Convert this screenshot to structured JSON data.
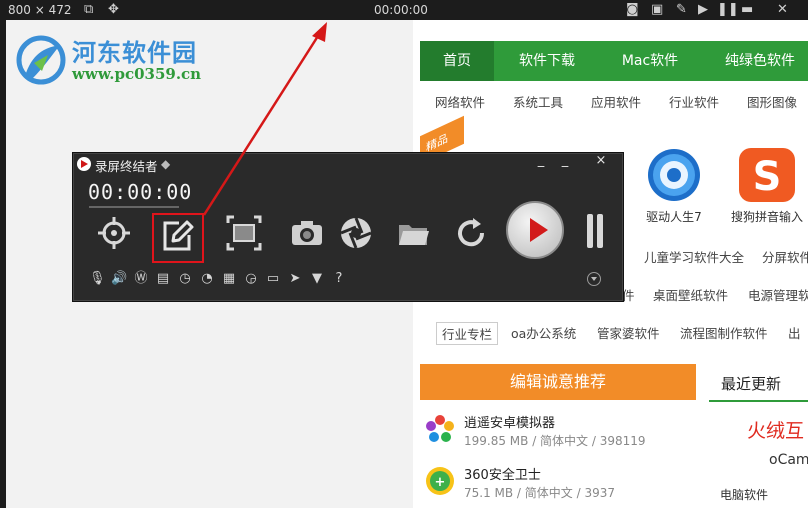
{
  "topbar": {
    "dimensions": "800 × 472",
    "time": "00:00:00"
  },
  "watermark": {
    "title": "河东软件园",
    "url": "www.pc0359.cn"
  },
  "site": {
    "nav": [
      "首页",
      "软件下载",
      "Mac软件",
      "纯绿色软件"
    ],
    "subnav": [
      "网络软件",
      "系统工具",
      "应用软件",
      "行业软件",
      "图形图像"
    ],
    "badge": "精品",
    "apps": [
      "驱动人生7",
      "搜狗拼音输入"
    ],
    "cat_row1": [
      "儿童学习软件大全",
      "分屏软件"
    ],
    "cat_row2": [
      "件",
      "桌面壁纸软件",
      "电源管理软"
    ],
    "cat_row3": [
      "行业专栏",
      "oa办公系统",
      "管家婆软件",
      "流程图制作软件",
      "出"
    ],
    "hot_title": "编辑诚意推荐",
    "latest_title": "最近更新",
    "latest_red": "火绒互",
    "latest_gray": "oCam",
    "latest_bottom": "电脑软件",
    "software": [
      {
        "name": "逍遥安卓模拟器",
        "meta": "199.85 MB / 简体中文 / 398119"
      },
      {
        "name": "360安全卫士",
        "meta": "75.1 MB / 简体中文 / 3937"
      }
    ]
  },
  "recorder": {
    "title": "录屏终结者",
    "time": "00:00:00",
    "window_buttons": [
      "_",
      "_",
      "×"
    ],
    "tools": [
      "target-icon",
      "edit-icon",
      "fullscreen-icon",
      "camera-icon",
      "aperture-icon",
      "folder-icon",
      "refresh-icon"
    ],
    "small_tools": [
      "mic-mute-icon",
      "speaker-icon",
      "wordpress-icon",
      "wordpress-alt-icon",
      "save-icon",
      "timer-icon",
      "clock-icon",
      "clapper-icon",
      "stopwatch-icon",
      "keyboard-icon",
      "cursor-icon",
      "tshirt-icon",
      "help-icon"
    ]
  },
  "colors": {
    "site_green": "#2f9b3a",
    "hot_orange": "#f28c28",
    "highlight_red": "#e0141b",
    "watermark_blue": "#3b8fd6"
  }
}
